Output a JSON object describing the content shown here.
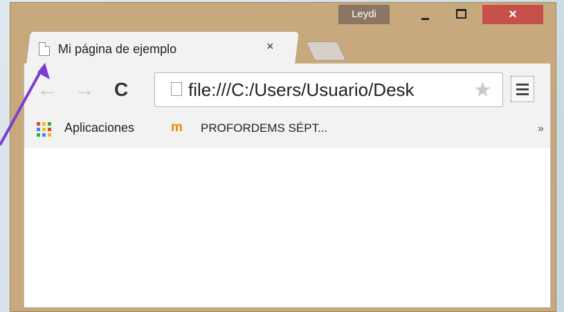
{
  "window": {
    "user": "Leydi",
    "close_symbol": "×"
  },
  "tab": {
    "title": "Mi página de ejemplo",
    "close_symbol": "×"
  },
  "toolbar": {
    "back_symbol": "←",
    "forward_symbol": "→",
    "reload_symbol": "C",
    "url": "file:///C:/Users/Usuario/Desk",
    "star_symbol": "★"
  },
  "bookmarks": {
    "apps_label": "Aplicaciones",
    "bookmark_label": "PROFORDEMS SÉPT...",
    "more_symbol": "»"
  },
  "colors": {
    "frame": "#c8a97d",
    "close_button": "#c7504a",
    "annotation_arrow": "#7a3fd1"
  }
}
